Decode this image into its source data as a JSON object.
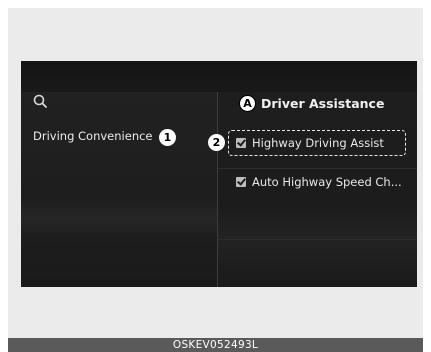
{
  "toolbar": {
    "search_icon": "search-icon"
  },
  "sidebar": {
    "items": [
      {
        "label": "Driving Convenience",
        "callout": "1"
      }
    ]
  },
  "panel": {
    "title": "Driver Assistance",
    "title_callout": "A",
    "options": [
      {
        "label": "Highway Driving Assist",
        "checked": true,
        "callout": "2",
        "highlighted": true
      },
      {
        "label": "Auto Highway Speed Ch...",
        "checked": true
      }
    ]
  },
  "caption": "OSKEV052493L",
  "colors": {
    "screen_bg": "#1c1c1c",
    "text": "#ebebeb",
    "callout_bg": "#ffffff",
    "caption_bg": "#5a5a5a"
  }
}
